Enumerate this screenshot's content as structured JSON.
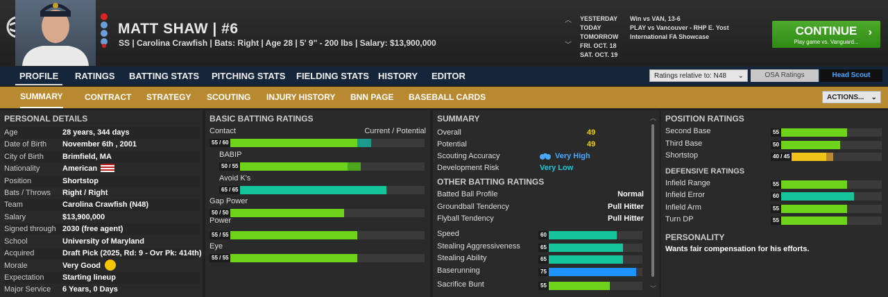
{
  "player": {
    "name": "MATT SHAW",
    "number": "#6",
    "info": "SS | Carolina Crawfish  |  Bats: Right  |  Age 28  |  5' 9\" - 200 lbs  |  Salary: $13,900,000"
  },
  "schedule": [
    {
      "day": "YESTERDAY",
      "event": "Win vs VAN, 13-6"
    },
    {
      "day": "TODAY",
      "event": "PLAY vs Vancouver - RHP E. Yost"
    },
    {
      "day": "TOMORROW",
      "event": "International FA Showcase"
    },
    {
      "day": "FRI. OCT. 18",
      "event": ""
    },
    {
      "day": "SAT. OCT. 19",
      "event": ""
    }
  ],
  "continue": {
    "label": "CONTINUE",
    "sub": "Play game vs. Vanguard..."
  },
  "nav1": {
    "tabs": [
      "PROFILE",
      "RATINGS",
      "BATTING STATS",
      "PITCHING STATS",
      "FIELDING STATS",
      "HISTORY",
      "EDITOR"
    ],
    "ratings_relative": "Ratings relative to: N48",
    "osa": "OSA Ratings",
    "head_scout": "Head Scout"
  },
  "nav2": {
    "tabs": [
      "SUMMARY",
      "CONTRACT",
      "STRATEGY",
      "SCOUTING",
      "INJURY HISTORY",
      "BNN PAGE",
      "BASEBALL CARDS"
    ],
    "actions": "ACTIONS..."
  },
  "personal": {
    "title": "PERSONAL DETAILS",
    "rows": [
      {
        "k": "Age",
        "v": "28 years, 344 days"
      },
      {
        "k": "Date of Birth",
        "v": "November 6th , 2001"
      },
      {
        "k": "City of Birth",
        "v": "Brimfield, MA"
      },
      {
        "k": "Nationality",
        "v": "American"
      },
      {
        "k": "Position",
        "v": "Shortstop"
      },
      {
        "k": "Bats / Throws",
        "v": "Right / Right"
      },
      {
        "k": "Team",
        "v": "Carolina Crawfish (N48)"
      },
      {
        "k": "Salary",
        "v": "$13,900,000"
      },
      {
        "k": "Signed through",
        "v": "2030 (free agent)"
      },
      {
        "k": "School",
        "v": "University of Maryland"
      },
      {
        "k": "Acquired",
        "v": "Draft Pick (2025, Rd: 9 - Ovr Pk: 414th)"
      },
      {
        "k": "Morale",
        "v": "Very Good"
      },
      {
        "k": "Expectation",
        "v": "Starting lineup"
      },
      {
        "k": "Major Service",
        "v": "6 Years, 0 Days"
      }
    ]
  },
  "batting": {
    "title": "BASIC BATTING RATINGS",
    "header_left": "Contact",
    "header_right": "Current / Potential",
    "items": [
      {
        "name": "Contact",
        "label": "55 / 60",
        "current": 55,
        "potential": 60,
        "color": "#6fd21b",
        "pcolor": "#1a9a8a"
      },
      {
        "name": "BABIP",
        "label": "50 / 55",
        "current": 50,
        "potential": 55,
        "color": "#6fd21b",
        "pcolor": "#4da61c"
      },
      {
        "name": "Avoid K's",
        "label": "65 / 65",
        "current": 65,
        "potential": 65,
        "color": "#14c49a",
        "pcolor": "#14c49a"
      },
      {
        "name": "Gap Power",
        "label": "50 / 50",
        "current": 50,
        "potential": 50,
        "color": "#6fd21b",
        "pcolor": "#6fd21b"
      },
      {
        "name": "Power",
        "label": "55 / 55",
        "current": 55,
        "potential": 55,
        "color": "#6fd21b",
        "pcolor": "#6fd21b"
      },
      {
        "name": "Eye",
        "label": "55 / 55",
        "current": 55,
        "potential": 55,
        "color": "#6fd21b",
        "pcolor": "#6fd21b"
      }
    ]
  },
  "summary": {
    "title": "SUMMARY",
    "overall_k": "Overall",
    "overall_v": "49",
    "potential_k": "Potential",
    "potential_v": "49",
    "scout_k": "Scouting Accuracy",
    "scout_v": "Very High",
    "risk_k": "Development Risk",
    "risk_v": "Very Low",
    "other_title": "OTHER BATTING RATINGS",
    "other": [
      {
        "k": "Batted Ball Profile",
        "v": "Normal"
      },
      {
        "k": "Groundball Tendency",
        "v": "Pull Hitter"
      },
      {
        "k": "Flyball Tendency",
        "v": "Pull Hitter"
      }
    ],
    "bars": [
      {
        "k": "Speed",
        "v": 60,
        "color": "#14c49a"
      },
      {
        "k": "Stealing Aggressiveness",
        "v": 65,
        "color": "#14c49a"
      },
      {
        "k": "Stealing Ability",
        "v": 65,
        "color": "#14c49a"
      },
      {
        "k": "Baserunning",
        "v": 75,
        "color": "#1e90ff"
      },
      {
        "k": "Sacrifice Bunt",
        "v": 55,
        "color": "#6fd21b"
      }
    ]
  },
  "position": {
    "title": "POSITION RATINGS",
    "items": [
      {
        "k": "Second Base",
        "label": "55",
        "value": 55,
        "color": "#6fd21b"
      },
      {
        "k": "Third Base",
        "label": "50",
        "value": 50,
        "color": "#6fd21b"
      },
      {
        "k": "Shortstop",
        "label": "40 / 45",
        "value": 40,
        "potential": 45,
        "color": "#f0c419",
        "pcolor": "#b8892f"
      }
    ],
    "def_title": "DEFENSIVE RATINGS",
    "def": [
      {
        "k": "Infield Range",
        "label": "55",
        "value": 55,
        "color": "#6fd21b"
      },
      {
        "k": "Infield Error",
        "label": "60",
        "value": 60,
        "color": "#14c49a"
      },
      {
        "k": "Infield Arm",
        "label": "55",
        "value": 55,
        "color": "#6fd21b"
      },
      {
        "k": "Turn DP",
        "label": "55",
        "value": 55,
        "color": "#6fd21b"
      }
    ],
    "personality_title": "PERSONALITY",
    "personality": "Wants fair compensation for his efforts."
  }
}
